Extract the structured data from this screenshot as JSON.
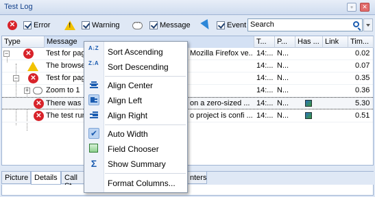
{
  "window": {
    "title": "Test Log",
    "buttons": [
      "▫",
      "✕"
    ]
  },
  "toolbar": {
    "error_label": "Error",
    "warning_label": "Warning",
    "message_label": "Message",
    "event_label": "Event",
    "search_value": "Search"
  },
  "grid": {
    "headers": [
      "Type",
      "Message",
      "T...",
      "P...",
      "Has ...",
      "Link",
      "Tim..."
    ],
    "rows": [
      {
        "message": "Test for pag",
        "message_tail": "Mozilla Firefox ve...",
        "time": "14:...",
        "p": "N...",
        "tim": "0.02"
      },
      {
        "message": "The browse",
        "message_tail": "",
        "time": "14:...",
        "p": "N...",
        "tim": "0.07"
      },
      {
        "message": "Test for pag",
        "message_tail": "",
        "time": "14:...",
        "p": "N...",
        "tim": "0.35"
      },
      {
        "message": "Zoom to 1",
        "message_tail": "",
        "time": "14:...",
        "p": "N...",
        "tim": "0.36"
      },
      {
        "message": "There was a",
        "message_tail": "on a zero-sized ...",
        "time": "14:...",
        "p": "N...",
        "tim": "5.30"
      },
      {
        "message": "The test run",
        "message_tail": "o project is confi ...",
        "time": "14:...",
        "p": "N...",
        "tim": "0.51"
      }
    ]
  },
  "tabs": [
    "Picture",
    "Details",
    "Call St",
    "nters"
  ],
  "context_menu": {
    "items": [
      "Sort Ascending",
      "Sort Descending",
      "Align Center",
      "Align Left",
      "Align Right",
      "Auto Width",
      "Field Chooser",
      "Show Summary",
      "Format Columns..."
    ],
    "sort_asc_glyph": "A↓Z",
    "sort_desc_glyph": "Z↓A"
  },
  "colors": {
    "error": "#d8232a",
    "warning": "#f2c200",
    "accent": "#1b5cb0"
  }
}
